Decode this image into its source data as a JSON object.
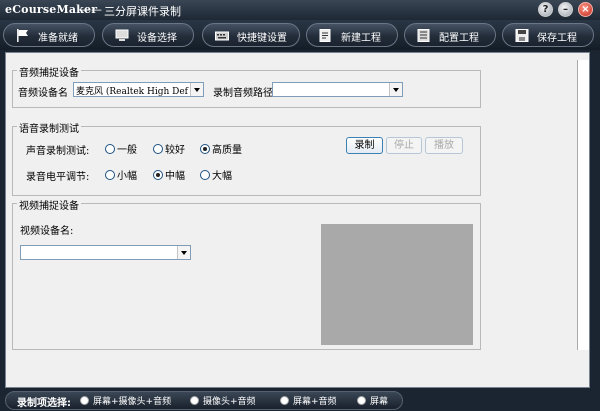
{
  "window": {
    "app_name": "eCourseMaker",
    "separator": "——",
    "subtitle": "三分屏课件录制"
  },
  "toolbar": {
    "buttons": [
      {
        "label": "准备就绪",
        "icon": "flag-icon"
      },
      {
        "label": "设备选择",
        "icon": "device-icon"
      },
      {
        "label": "快捷键设置",
        "icon": "keyboard-icon"
      },
      {
        "label": "新建工程",
        "icon": "new-project-icon"
      },
      {
        "label": "配置工程",
        "icon": "config-icon"
      },
      {
        "label": "保存工程",
        "icon": "save-icon"
      }
    ]
  },
  "audio_capture": {
    "title": "音频捕捉设备",
    "device_label": "音频设备名",
    "device_value": "麦克风 (Realtek High Def",
    "path_label": "录制音频路径",
    "path_value": ""
  },
  "voice_test": {
    "title": "语音录制测试",
    "quality_label": "声音录制测试:",
    "quality_options": [
      "一般",
      "较好",
      "高质量"
    ],
    "quality_selected": 2,
    "level_label": "录音电平调节:",
    "level_options": [
      "小幅",
      "中幅",
      "大幅"
    ],
    "level_selected": 1,
    "record_label": "录制",
    "stop_label": "停止",
    "play_label": "播放"
  },
  "video_capture": {
    "title": "视频捕捉设备",
    "device_label": "视频设备名:",
    "device_value": ""
  },
  "bottom_bar": {
    "caption": "录制项选择:",
    "options": [
      "屏幕+摄像头+音频",
      "摄像头+音频",
      "屏幕+音频",
      "屏幕"
    ],
    "selected": -1
  },
  "colors": {
    "frame": "#1b2532",
    "panel": "#f0f0f0",
    "close_button": "#c0261a",
    "preview": "#a9a9a9"
  }
}
